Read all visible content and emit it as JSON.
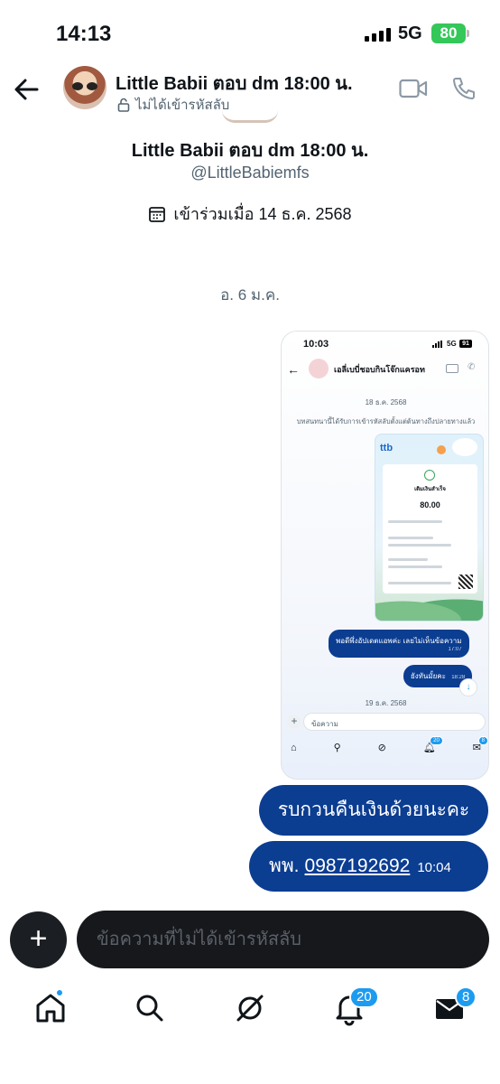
{
  "status_bar": {
    "time": "14:13",
    "network": "5G",
    "battery": "80"
  },
  "header": {
    "name": "Little Babii ตอบ dm 18:00 น.",
    "encryption_label": "ไม่ได้เข้ารหัสลับ"
  },
  "profile": {
    "name": "Little Babii ตอบ dm 18:00 น.",
    "handle": "@LittleBabiemfs",
    "joined": "เข้าร่วมเมื่อ 14 ธ.ค. 2568"
  },
  "date_separator": "อ. 6 ม.ค.",
  "screenshot_message": {
    "time": "10:03",
    "network": "5G",
    "battery": "91",
    "chat_name": "เอลี่เบบี่ชอบกินโจ๊กแครอท",
    "date1": "18 ธ.ค. 2568",
    "notice": "บทสนทนานี้ได้รับการเข้ารหัสลับตั้งแต่ต้นทางถึงปลายทางแล้ว",
    "receipt": {
      "bank_logo": "ttb",
      "status": "เติมเงินสำเร็จ",
      "amount": "80.00"
    },
    "bubble1_text": "พอดีพึ่งอัปเดตแอพค่ะ เลยไม่เห็นข้อความ",
    "bubble1_time": "17:07",
    "bubble2_text": "ยังทันมั้ยคะ",
    "bubble2_time": "18:28",
    "date2": "19 ธ.ค. 2568",
    "input_placeholder": "ข้อความ",
    "notif_badge": "20",
    "msg_badge": "8"
  },
  "messages": [
    {
      "text": "รบกวนคืนเงินด้วยนะคะ"
    },
    {
      "prefix": "พพ.",
      "number": "0987192692",
      "time": "10:04"
    }
  ],
  "composer": {
    "plus": "+",
    "placeholder": "ข้อความที่ไม่ได้เข้ารหัสลับ"
  },
  "nav": {
    "notifications_badge": "20",
    "messages_badge": "8"
  },
  "colors": {
    "bubble": "#0b3d91",
    "accent": "#1d9bf0"
  }
}
